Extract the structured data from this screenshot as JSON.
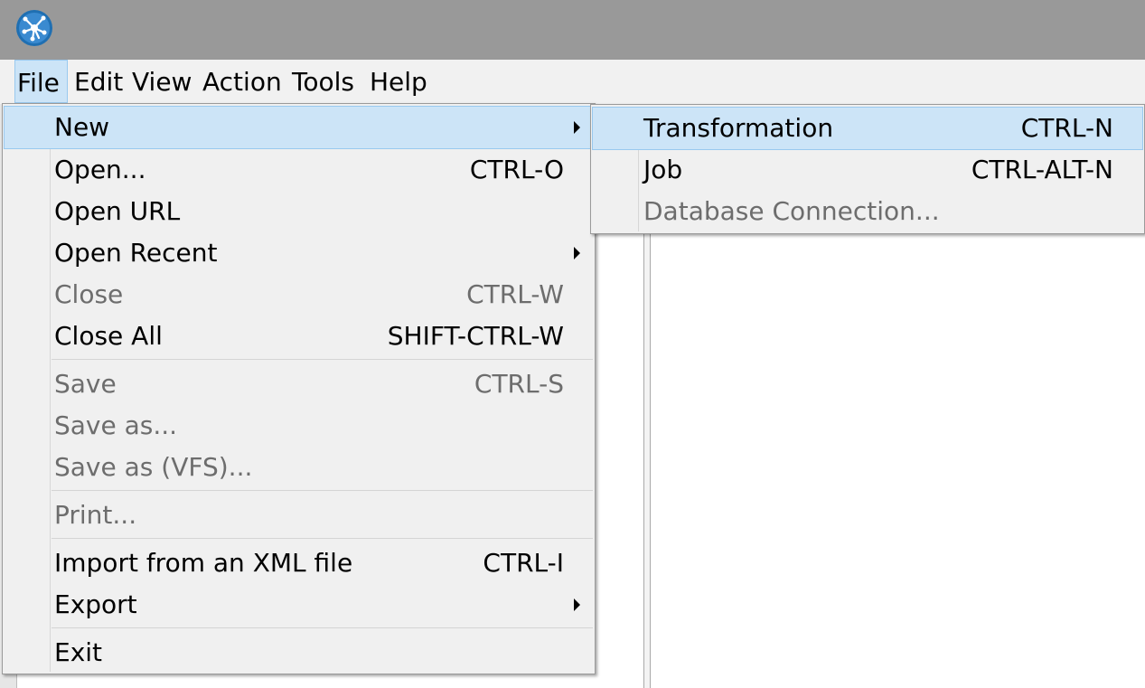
{
  "menubar": {
    "items": [
      {
        "label": "File"
      },
      {
        "label": "Edit"
      },
      {
        "label": "View"
      },
      {
        "label": "Action"
      },
      {
        "label": "Tools"
      },
      {
        "label": "Help"
      }
    ]
  },
  "file_menu": {
    "items": [
      {
        "label": "New",
        "shortcut": "",
        "submenu": true,
        "highlighted": true
      },
      {
        "label": "Open...",
        "shortcut": "CTRL-O"
      },
      {
        "label": "Open URL",
        "shortcut": ""
      },
      {
        "label": "Open Recent",
        "shortcut": "",
        "submenu": true
      },
      {
        "label": "Close",
        "shortcut": "CTRL-W",
        "disabled": true
      },
      {
        "label": "Close All",
        "shortcut": "SHIFT-CTRL-W"
      },
      {
        "label": "Save",
        "shortcut": "CTRL-S",
        "disabled": true
      },
      {
        "label": "Save as...",
        "shortcut": "",
        "disabled": true
      },
      {
        "label": "Save as (VFS)...",
        "shortcut": "",
        "disabled": true
      },
      {
        "label": "Print...",
        "shortcut": "",
        "disabled": true
      },
      {
        "label": "Import from an XML file",
        "shortcut": "CTRL-I"
      },
      {
        "label": "Export",
        "shortcut": "",
        "submenu": true
      },
      {
        "label": "Exit",
        "shortcut": ""
      }
    ]
  },
  "new_submenu": {
    "items": [
      {
        "label": "Transformation",
        "shortcut": "CTRL-N",
        "highlighted": true
      },
      {
        "label": "Job",
        "shortcut": "CTRL-ALT-N"
      },
      {
        "label": "Database Connection...",
        "shortcut": "",
        "disabled": true
      }
    ]
  },
  "colors": {
    "titlebar": "#999999",
    "highlight": "#cce4f7",
    "highlight_border": "#99c9ef",
    "menu_bg": "#f0f0f0",
    "disabled_text": "#6d6d6d"
  },
  "icons": {
    "app": "kettle-spoon-logo-icon",
    "submenu": "submenu-arrow-icon"
  }
}
